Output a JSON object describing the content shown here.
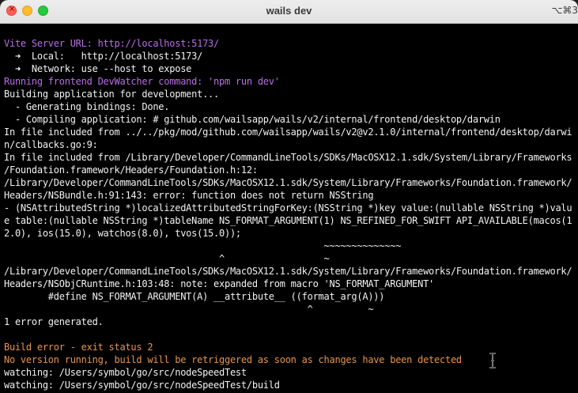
{
  "window": {
    "title": "wails dev",
    "shortcut": "⌥⌘3"
  },
  "terminal": {
    "lines": [
      {
        "text": "Vite Server URL: http://localhost:5173/",
        "color": "#b86fe6"
      },
      {
        "text": "  ➜  Local:   http://localhost:5173/",
        "color": "#f2f2f2"
      },
      {
        "text": "  ➜  Network: use --host to expose",
        "color": "#f2f2f2"
      },
      {
        "text": "Running frontend DevWatcher command: 'npm run dev'",
        "color": "#b86fe6"
      },
      {
        "text": "Building application for development...",
        "color": "#f2f2f2"
      },
      {
        "text": "  - Generating bindings: Done.",
        "color": "#f2f2f2"
      },
      {
        "text": "  - Compiling application: # github.com/wailsapp/wails/v2/internal/frontend/desktop/darwin",
        "color": "#f2f2f2"
      },
      {
        "text": "In file included from ../../pkg/mod/github.com/wailsapp/wails/v2@v2.1.0/internal/frontend/desktop/darwi",
        "color": "#f2f2f2"
      },
      {
        "text": "n/callbacks.go:9:",
        "color": "#f2f2f2"
      },
      {
        "text": "In file included from /Library/Developer/CommandLineTools/SDKs/MacOSX12.1.sdk/System/Library/Frameworks",
        "color": "#f2f2f2"
      },
      {
        "text": "/Foundation.framework/Headers/Foundation.h:12:",
        "color": "#f2f2f2"
      },
      {
        "text": "/Library/Developer/CommandLineTools/SDKs/MacOSX12.1.sdk/System/Library/Frameworks/Foundation.framework/",
        "color": "#f2f2f2"
      },
      {
        "text": "Headers/NSBundle.h:91:143: error: function does not return NSString",
        "color": "#f2f2f2"
      },
      {
        "text": "- (NSAttributedString *)localizedAttributedStringForKey:(NSString *)key value:(nullable NSString *)valu",
        "color": "#f2f2f2"
      },
      {
        "text": "e table:(nullable NSString *)tableName NS_FORMAT_ARGUMENT(1) NS_REFINED_FOR_SWIFT API_AVAILABLE(macos(1",
        "color": "#f2f2f2"
      },
      {
        "text": "2.0), ios(15.0), watchos(8.0), tvos(15.0));",
        "color": "#f2f2f2"
      },
      {
        "text": "                                                          ~~~~~~~~~~~~~~",
        "color": "#f2f2f2"
      },
      {
        "text": "                                       ^                  ~",
        "color": "#f2f2f2"
      },
      {
        "text": "/Library/Developer/CommandLineTools/SDKs/MacOSX12.1.sdk/System/Library/Frameworks/Foundation.framework/",
        "color": "#f2f2f2"
      },
      {
        "text": "Headers/NSObjCRuntime.h:103:48: note: expanded from macro 'NS_FORMAT_ARGUMENT'",
        "color": "#f2f2f2"
      },
      {
        "text": "        #define NS_FORMAT_ARGUMENT(A) __attribute__ ((format_arg(A)))",
        "color": "#f2f2f2"
      },
      {
        "text": "                                                       ^          ~",
        "color": "#f2f2f2"
      },
      {
        "text": "1 error generated.",
        "color": "#f2f2f2"
      },
      {
        "text": "",
        "color": "#f2f2f2"
      },
      {
        "text": "Build error - exit status 2",
        "color": "#e8944a"
      },
      {
        "text": "No version running, build will be retriggered as soon as changes have been detected",
        "color": "#e8944a"
      },
      {
        "text": "watching: /Users/symbol/go/src/nodeSpeedTest",
        "color": "#f2f2f2"
      },
      {
        "text": "watching: /Users/symbol/go/src/nodeSpeedTest/build",
        "color": "#f2f2f2"
      }
    ]
  },
  "icons": {
    "close": "close-icon",
    "cursor": "text-cursor-icon"
  }
}
